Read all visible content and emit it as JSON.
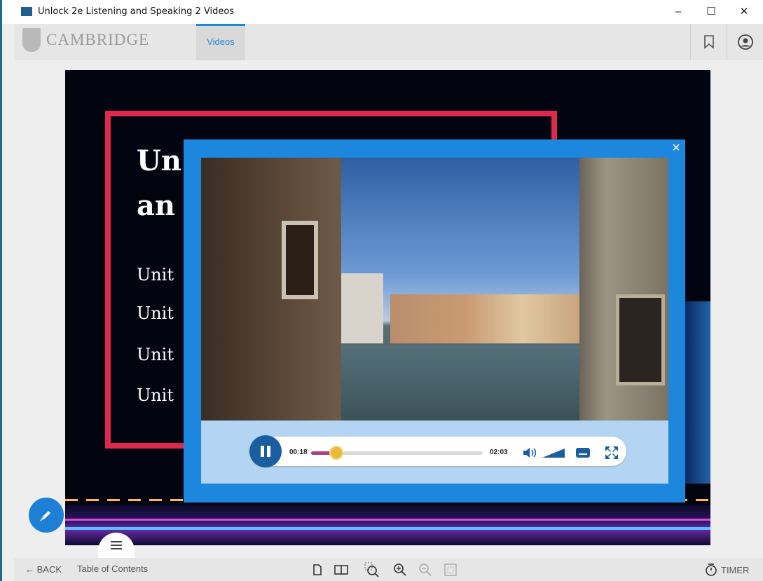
{
  "window": {
    "title": "Unlock 2e Listening and Speaking 2 Videos",
    "minimize": "–",
    "maximize": "☐",
    "close": "✕"
  },
  "header": {
    "logo_text": "CAMBRIDGE",
    "tab_label": "Videos"
  },
  "slide": {
    "title_line1": "Un",
    "title_line2": "an",
    "units": [
      "Unit",
      "Unit",
      "Unit",
      "Unit"
    ]
  },
  "player": {
    "close_glyph": "×",
    "current_time": "00:18",
    "duration": "02:03",
    "progress_fraction": 0.146
  },
  "bottom": {
    "back_label": "BACK",
    "toc_label": "Table of Contents",
    "timer_label": "TIMER"
  },
  "colors": {
    "accent": "#1d86dd",
    "frame": "#e0284f",
    "progress": "#b0407f"
  }
}
